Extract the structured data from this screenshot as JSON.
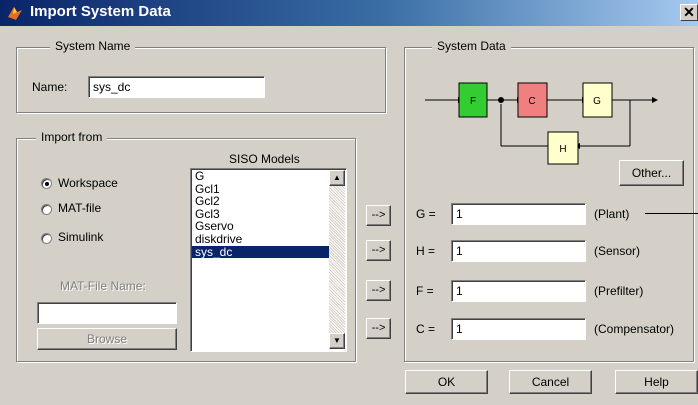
{
  "window": {
    "title": "Import System Data",
    "close_glyph": "✕"
  },
  "system_name": {
    "group_label": "System Name",
    "name_label": "Name:",
    "name_value": "sys_dc"
  },
  "import_from": {
    "group_label": "Import from",
    "options": [
      {
        "label": "Workspace",
        "selected": true
      },
      {
        "label": "MAT-file",
        "selected": false
      },
      {
        "label": "Simulink",
        "selected": false
      }
    ],
    "mat_file_label": "MAT-File Name:",
    "mat_file_value": "",
    "browse_label": "Browse",
    "siso_label": "SISO Models",
    "models": [
      "G",
      "Gcl1",
      "Gcl2",
      "Gcl3",
      "Gservo",
      "diskdrive",
      "sys_dc"
    ],
    "selected_model": "sys_dc"
  },
  "arrow_buttons": [
    "-->",
    "-->",
    "-->",
    "-->"
  ],
  "system_data": {
    "group_label": "System Data",
    "diagram": {
      "F": "F",
      "C": "C",
      "G": "G",
      "H": "H",
      "colors": {
        "F": "#33cc33",
        "C": "#f08080",
        "G": "#ffffcc",
        "H": "#ffffcc"
      }
    },
    "other_label": "Other...",
    "fields": [
      {
        "label": "G =",
        "value": "1",
        "role": "(Plant)"
      },
      {
        "label": "H =",
        "value": "1",
        "role": "(Sensor)"
      },
      {
        "label": "F =",
        "value": "1",
        "role": "(Prefilter)"
      },
      {
        "label": "C =",
        "value": "1",
        "role": "(Compensator)"
      }
    ]
  },
  "footer": {
    "ok": "OK",
    "cancel": "Cancel",
    "help": "Help"
  }
}
